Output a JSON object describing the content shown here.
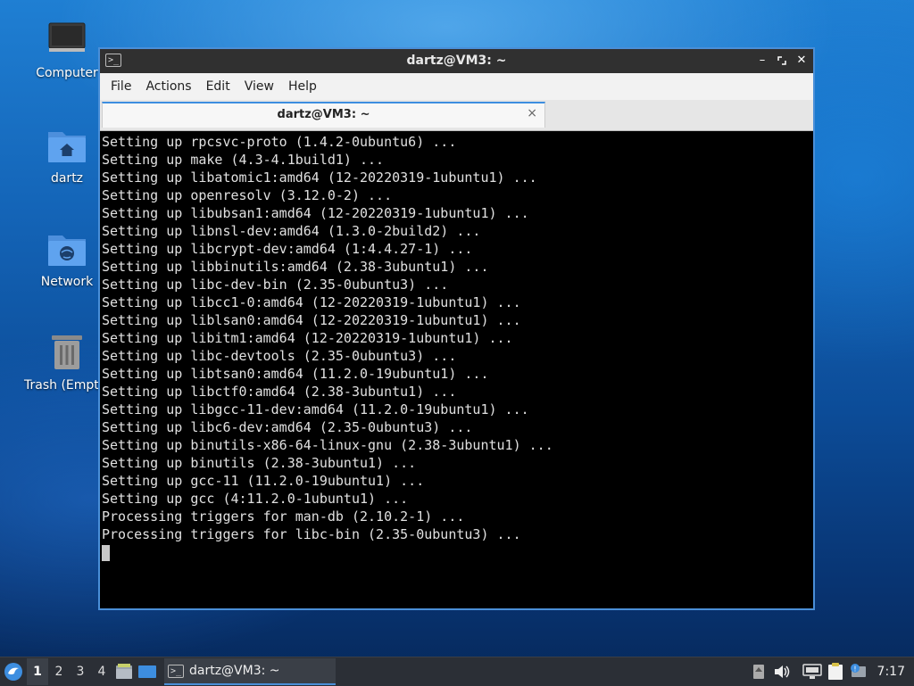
{
  "desktop": {
    "icons": [
      {
        "label": "Computer",
        "icon": "computer-icon"
      },
      {
        "label": "dartz",
        "icon": "home-folder-icon"
      },
      {
        "label": "Network",
        "icon": "network-folder-icon"
      },
      {
        "label": "Trash (Empty)",
        "icon": "trash-icon"
      }
    ]
  },
  "window": {
    "title": "dartz@VM3: ~",
    "buttons": {
      "minimize": "minimize-icon",
      "maximize": "maximize-icon",
      "close": "close-icon"
    },
    "menu": [
      "File",
      "Actions",
      "Edit",
      "View",
      "Help"
    ],
    "tab": {
      "title": "dartz@VM3: ~",
      "close": "×"
    }
  },
  "terminal": {
    "lines": [
      "Setting up rpcsvc-proto (1.4.2-0ubuntu6) ...",
      "Setting up make (4.3-4.1build1) ...",
      "Setting up libatomic1:amd64 (12-20220319-1ubuntu1) ...",
      "Setting up openresolv (3.12.0-2) ...",
      "Setting up libubsan1:amd64 (12-20220319-1ubuntu1) ...",
      "Setting up libnsl-dev:amd64 (1.3.0-2build2) ...",
      "Setting up libcrypt-dev:amd64 (1:4.4.27-1) ...",
      "Setting up libbinutils:amd64 (2.38-3ubuntu1) ...",
      "Setting up libc-dev-bin (2.35-0ubuntu3) ...",
      "Setting up libcc1-0:amd64 (12-20220319-1ubuntu1) ...",
      "Setting up liblsan0:amd64 (12-20220319-1ubuntu1) ...",
      "Setting up libitm1:amd64 (12-20220319-1ubuntu1) ...",
      "Setting up libc-devtools (2.35-0ubuntu3) ...",
      "Setting up libtsan0:amd64 (11.2.0-19ubuntu1) ...",
      "Setting up libctf0:amd64 (2.38-3ubuntu1) ...",
      "Setting up libgcc-11-dev:amd64 (11.2.0-19ubuntu1) ...",
      "Setting up libc6-dev:amd64 (2.35-0ubuntu3) ...",
      "Setting up binutils-x86-64-linux-gnu (2.38-3ubuntu1) ...",
      "Setting up binutils (2.38-3ubuntu1) ...",
      "Setting up gcc-11 (11.2.0-19ubuntu1) ...",
      "Setting up gcc (4:11.2.0-1ubuntu1) ...",
      "Processing triggers for man-db (2.10.2-1) ...",
      "Processing triggers for libc-bin (2.35-0ubuntu3) ..."
    ]
  },
  "taskbar": {
    "workspaces": [
      "1",
      "2",
      "3",
      "4"
    ],
    "active_workspace": "1",
    "task_label": "dartz@VM3: ~",
    "clock": "7:17"
  },
  "colors": {
    "accent": "#4a8fd8",
    "terminal_bg": "#000000",
    "terminal_fg": "#e0e0e0"
  }
}
